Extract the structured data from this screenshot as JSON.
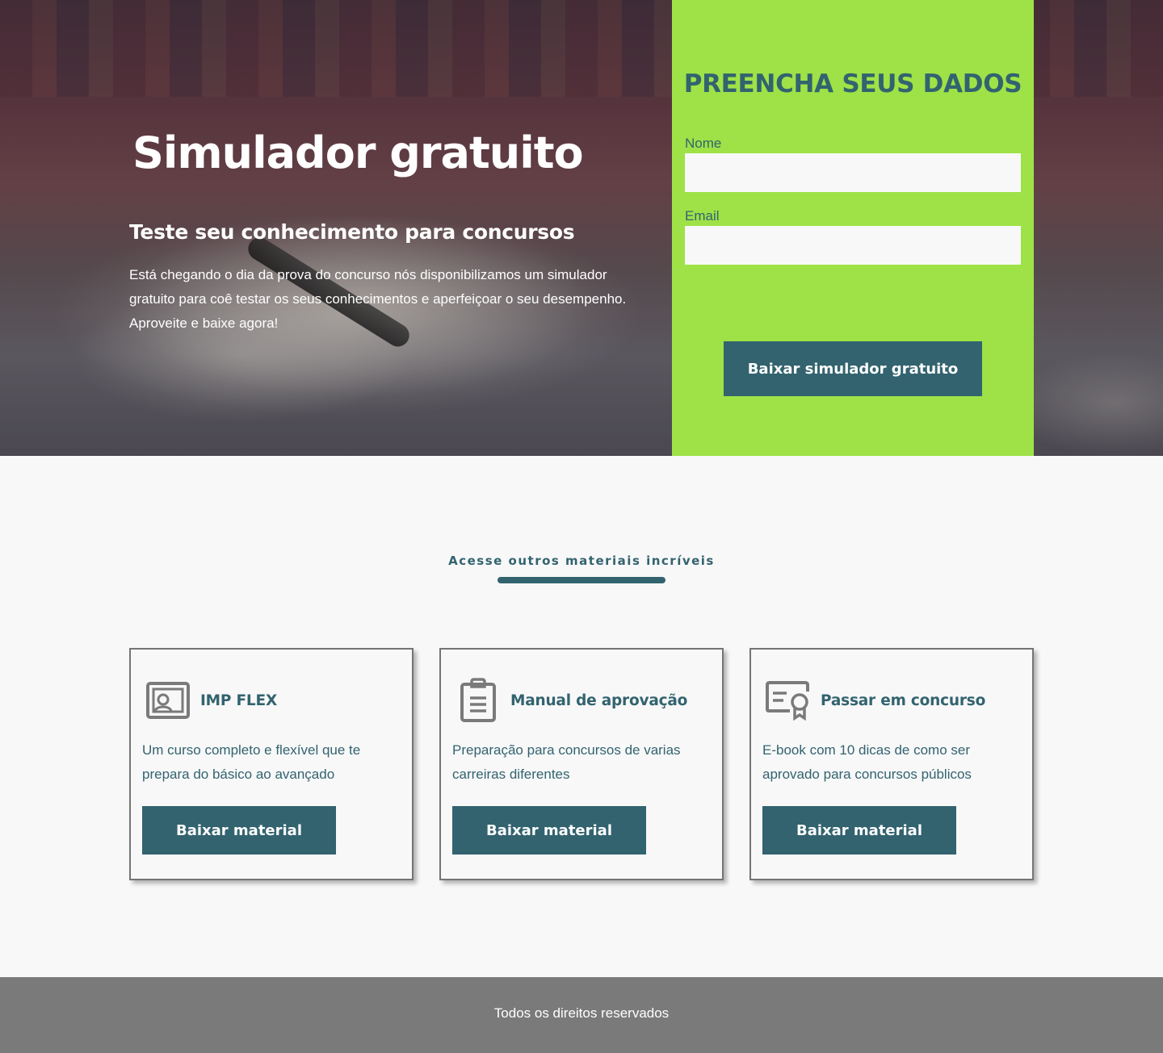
{
  "hero": {
    "title": "Simulador gratuito",
    "subtitle": "Teste seu conhecimento para concursos",
    "description": "Está chegando o dia da prova do concurso nós disponibilizamos um simulador gratuito para coê testar os seus conhecimentos e aperfeiçoar o seu desempenho. Aproveite e baixe agora!"
  },
  "form": {
    "title": "PREENCHA SEUS DADOS",
    "name_label": "Nome",
    "name_value": "",
    "email_label": "Email",
    "email_value": "",
    "submit_label": "Baixar simulador gratuito"
  },
  "materials": {
    "title": "Acesse outros materiais incríveis",
    "cards": [
      {
        "icon": "certificate-user-icon",
        "title": "IMP FLEX",
        "description": "Um curso completo e flexível que te prepara do básico ao avançado",
        "button": "Baixar material"
      },
      {
        "icon": "clipboard-icon",
        "title": "Manual de aprovação",
        "description": "Preparação para concursos de varias carreiras diferentes",
        "button": "Baixar material"
      },
      {
        "icon": "certificate-award-icon",
        "title": "Passar em concurso",
        "description": "E-book com 10 dicas de como ser aprovado para concursos públicos",
        "button": "Baixar material"
      }
    ]
  },
  "footer": {
    "text": "Todos os direitos reservados"
  },
  "colors": {
    "accent_green": "#9ee247",
    "primary_teal": "#32636f",
    "footer_gray": "#7a7a7a",
    "background": "#f8f8f8"
  }
}
